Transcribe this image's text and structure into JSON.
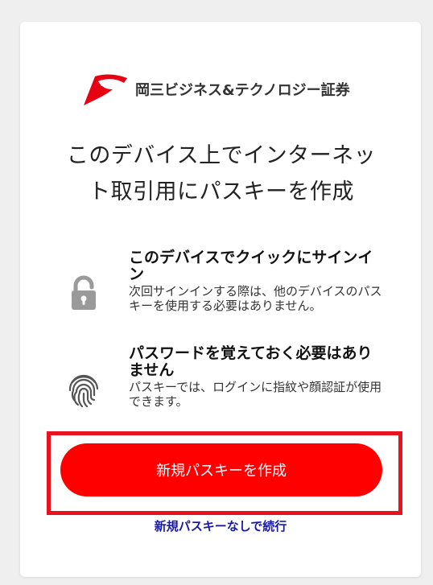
{
  "brand": {
    "name": "岡三ビジネス&テクノロジー証券",
    "logo_icon": "okasan-wing-logo",
    "logo_color": "#e60012"
  },
  "title": "このデバイス上でインターネット取引用にパスキーを作成",
  "features": [
    {
      "icon": "lock-icon",
      "title": "このデバイスでクイックにサインイン",
      "description": "次回サインインする際は、他のデバイスのパスキーを使用する必要はありません。"
    },
    {
      "icon": "fingerprint-icon",
      "title": "パスワードを覚えておく必要はありません",
      "description": "パスキーでは、ログインに指紋や顔認証が使用できます。"
    }
  ],
  "actions": {
    "create_label": "新規パスキーを作成",
    "skip_label": "新規パスキーなしで続行"
  },
  "colors": {
    "primary_button": "#ff0000",
    "highlight_border": "#e8131f",
    "link": "#1a1aa8",
    "icon_gray": "#9a9a9a"
  }
}
